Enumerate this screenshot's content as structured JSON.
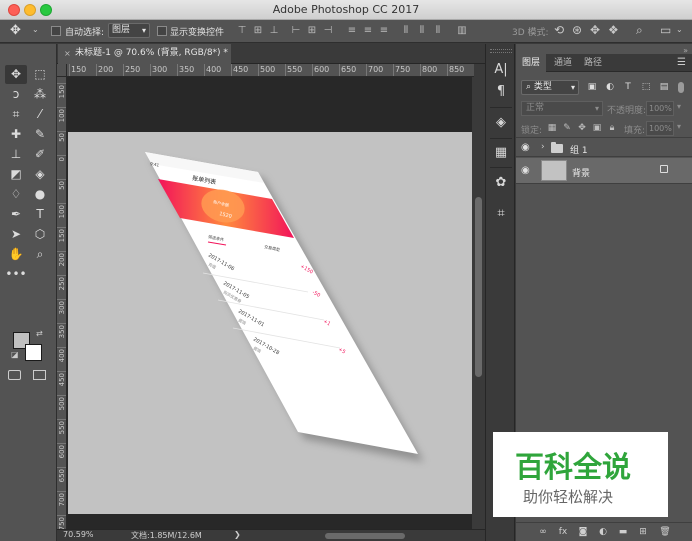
{
  "app": {
    "title": "Adobe Photoshop CC 2017"
  },
  "options_bar": {
    "auto_select_label": "自动选择:",
    "auto_select_target": "图层",
    "show_transform_label": "显示变换控件",
    "mode_3d_label": "3D 模式:"
  },
  "document": {
    "tab_title": "未标题-1 @ 70.6% (背景, RGB/8*) *",
    "close_glyph": "×"
  },
  "rulers": {
    "horizontal": [
      "150",
      "200",
      "250",
      "300",
      "350",
      "400",
      "450",
      "500",
      "550",
      "600",
      "650",
      "700",
      "750",
      "800",
      "850"
    ],
    "vertical": [
      "150",
      "100",
      "50",
      "0",
      "50",
      "100",
      "150",
      "200",
      "250",
      "300",
      "350",
      "400",
      "450",
      "500",
      "550",
      "600",
      "650",
      "700",
      "750"
    ]
  },
  "mockup": {
    "status_time": "9:41",
    "page_title": "账单列表",
    "banner_label": "账户余额",
    "banner_value": "1520",
    "filter_tab_1": "筛选条件",
    "filter_tab_2": "交易类型",
    "rows": [
      {
        "date": "2017-11-06",
        "desc": "充值",
        "amount": "+150"
      },
      {
        "date": "2017-11-05",
        "desc": "购买优惠券",
        "amount": "-50"
      },
      {
        "date": "2017-11-01",
        "desc": "提现",
        "amount": "+1"
      },
      {
        "date": "2017-10-28",
        "desc": "提现",
        "amount": "+5"
      }
    ]
  },
  "status_bar": {
    "zoom": "70.59%",
    "doc_info": "文档:1.85M/12.6M",
    "arrow": "❯"
  },
  "layers_panel": {
    "tabs": [
      "图层",
      "通道",
      "路径"
    ],
    "filter_kind": "类型",
    "blend_mode": "正常",
    "opacity_label": "不透明度:",
    "opacity_value": "100%",
    "lock_label": "锁定:",
    "fill_label": "填充:",
    "fill_value": "100%",
    "layers": [
      {
        "name": "组 1",
        "type": "group"
      },
      {
        "name": "背景",
        "type": "background"
      }
    ]
  },
  "watermark": {
    "title": "百科全说",
    "subtitle": "助你轻松解决",
    "title_color": "#2fa53b",
    "subtitle_color": "#666666"
  },
  "colors": {
    "accent_pink": "#f2135a",
    "accent_orange": "#ff8a3d",
    "canvas_gray": "#c2c2c2",
    "panel_gray": "#535353"
  }
}
